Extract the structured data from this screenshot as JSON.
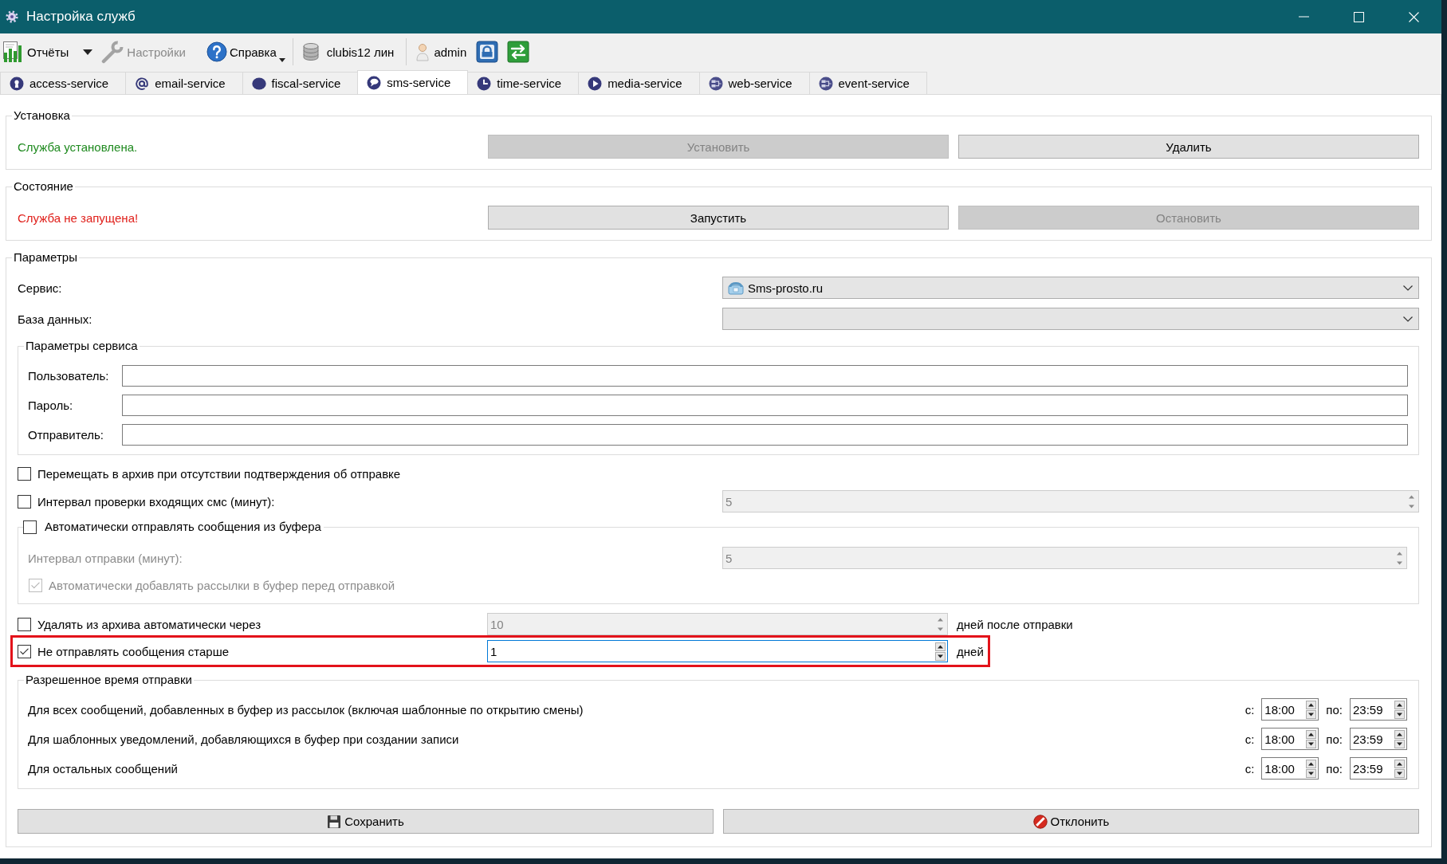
{
  "window": {
    "title": "Настройка служб"
  },
  "toolbar": {
    "items": [
      {
        "label": "Отчёты",
        "disabled": false,
        "kind": "split-menu"
      },
      {
        "label": "Настройки",
        "disabled": true,
        "kind": "button"
      },
      {
        "label": "Справка",
        "disabled": false,
        "kind": "menu-button"
      }
    ],
    "database": "clubis12 лин",
    "user": "admin"
  },
  "tabs": [
    {
      "label": "access-service",
      "selected": false
    },
    {
      "label": "email-service",
      "selected": false
    },
    {
      "label": "fiscal-service",
      "selected": false
    },
    {
      "label": "sms-service",
      "selected": true
    },
    {
      "label": "time-service",
      "selected": false
    },
    {
      "label": "media-service",
      "selected": false
    },
    {
      "label": "web-service",
      "selected": false
    },
    {
      "label": "event-service",
      "selected": false
    }
  ],
  "sections": [
    {
      "title": "Установка",
      "status": "Служба установлена.",
      "kind": "ok",
      "buttons": [
        {
          "label": "Установить",
          "disabled": true
        },
        {
          "label": "Удалить",
          "disabled": false
        }
      ]
    },
    {
      "title": "Состояние",
      "status": "Служба не запущена!",
      "kind": "error",
      "buttons": [
        {
          "label": "Запустить",
          "disabled": false
        },
        {
          "label": "Остановить",
          "disabled": true
        }
      ]
    }
  ],
  "parameters": {
    "title": "Параметры",
    "selects": [
      {
        "label": "Сервис:",
        "value": "Sms-prosto.ru"
      },
      {
        "label": "База данных:"
      }
    ],
    "service_params": {
      "title": "Параметры сервиса",
      "fields": [
        {
          "label": "Пользователь:"
        },
        {
          "label": "Пароль:"
        },
        {
          "label": "Отправитель:"
        }
      ]
    },
    "options": [
      {
        "kind": "checkbox",
        "label": "Перемещать в архив при отсутствии подтверждения об отправке",
        "checked": false,
        "disabled": false,
        "highlighted": false
      },
      {
        "kind": "checkbox-spin",
        "label": "Интервал проверки входящих смс (минут):",
        "checked": false,
        "disabled": false,
        "highlighted": false,
        "spin": {
          "value": "5",
          "disabled": true,
          "focused": false
        }
      },
      {
        "kind": "group",
        "label": "Автоматически отправлять сообщения из буфера",
        "checked": false,
        "disabled": false,
        "rows": [
          {
            "kind": "label-spin",
            "label": "Интервал отправки (минут):",
            "disabled": true,
            "spin": {
              "value": "5",
              "disabled": true,
              "focused": false
            }
          },
          {
            "kind": "checkbox",
            "label": "Автоматически добавлять рассылки в буфер перед отправкой",
            "checked": true,
            "disabled": true
          }
        ]
      },
      {
        "kind": "checkbox-spin-unit",
        "label": "Удалять из архива автоматически через",
        "checked": false,
        "disabled": false,
        "highlighted": false,
        "spin": {
          "value": "10",
          "disabled": true,
          "focused": false
        },
        "unit": "дней после отправки"
      },
      {
        "kind": "checkbox-spin-unit",
        "label": "Не отправлять сообщения старше",
        "checked": true,
        "disabled": false,
        "highlighted": true,
        "spin": {
          "value": "1",
          "disabled": false,
          "focused": true
        },
        "unit": "дней"
      }
    ],
    "send_time": {
      "title": "Разрешенное время отправки",
      "rows": [
        {
          "label": "Для всех сообщений, добавленных в буфер из рассылок (включая шаблонные по открытию смены)",
          "from_label": "с:",
          "from": "18:00",
          "to_label": "по:",
          "to": "23:59"
        },
        {
          "label": "Для шаблонных уведомлений, добавляющихся в буфер при создании записи",
          "from_label": "с:",
          "from": "18:00",
          "to_label": "по:",
          "to": "23:59"
        },
        {
          "label": "Для остальных сообщений",
          "from_label": "с:",
          "from": "18:00",
          "to_label": "по:",
          "to": "23:59"
        }
      ]
    },
    "buttons": [
      {
        "label": "Сохранить"
      },
      {
        "label": "Отклонить"
      }
    ]
  }
}
